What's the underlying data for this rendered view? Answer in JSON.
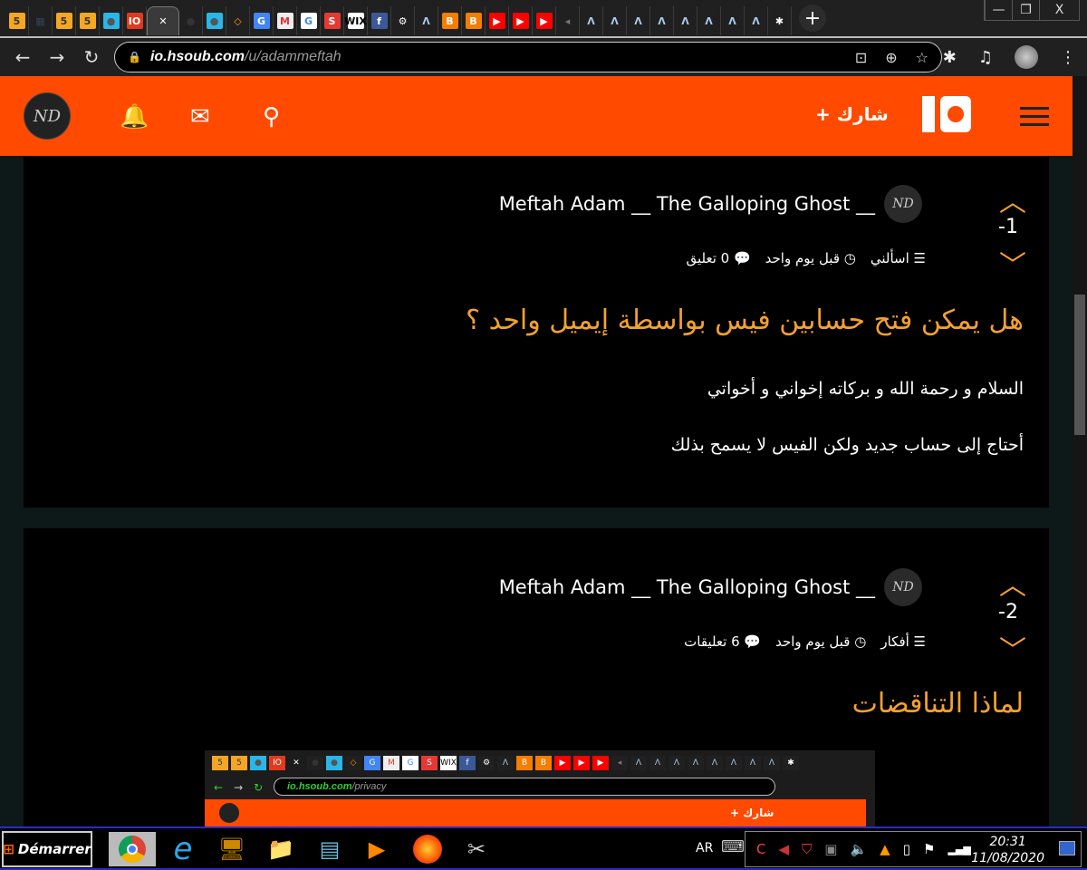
{
  "browser": {
    "tabs": [
      {
        "icon": "html5-icon",
        "glyph": "5",
        "bg": "#f5a623",
        "fg": "#333"
      },
      {
        "icon": "grid-icon",
        "glyph": "▦",
        "bg": "#202020",
        "fg": "#345"
      },
      {
        "icon": "html5-icon",
        "glyph": "5",
        "bg": "#f5a623",
        "fg": "#333"
      },
      {
        "icon": "html5-icon",
        "glyph": "5",
        "bg": "#f5a623",
        "fg": "#333"
      },
      {
        "icon": "circle-app-icon",
        "glyph": "●",
        "bg": "#29b6e8",
        "fg": "#555"
      },
      {
        "icon": "io-icon",
        "glyph": "IO",
        "bg": "#e03a1e",
        "fg": "#fff"
      },
      {
        "icon": "close-icon",
        "glyph": "✕",
        "active": true
      },
      {
        "icon": "dot-icon",
        "glyph": "●",
        "bg": "#202020",
        "fg": "#333"
      },
      {
        "icon": "circle-app-icon",
        "glyph": "●",
        "bg": "#29b6e8",
        "fg": "#555"
      },
      {
        "icon": "diamond-icon",
        "glyph": "◇",
        "bg": "#202020",
        "fg": "#f90"
      },
      {
        "icon": "google-translate-icon",
        "glyph": "G",
        "bg": "#4285f4",
        "fg": "#fff"
      },
      {
        "icon": "gmail-icon",
        "glyph": "M",
        "bg": "#eee",
        "fg": "#d33"
      },
      {
        "icon": "google-icon",
        "glyph": "G",
        "bg": "#fff",
        "fg": "#4285f4"
      },
      {
        "icon": "s-icon",
        "glyph": "S",
        "bg": "#e53935",
        "fg": "#fff"
      },
      {
        "icon": "wix-icon",
        "glyph": "WIX",
        "bg": "#fff",
        "fg": "#000"
      },
      {
        "icon": "facebook-icon",
        "glyph": "f",
        "bg": "#3b5998",
        "fg": "#fff"
      },
      {
        "icon": "gear-icon",
        "glyph": "⚙",
        "bg": "#202020",
        "fg": "#fff"
      },
      {
        "icon": "lambda-icon",
        "glyph": "Λ",
        "bg": "#202020",
        "fg": "#ace"
      },
      {
        "icon": "blogger-icon",
        "glyph": "B",
        "bg": "#f57d00",
        "fg": "#fff"
      },
      {
        "icon": "blogger-icon",
        "glyph": "B",
        "bg": "#f57d00",
        "fg": "#fff"
      },
      {
        "icon": "youtube-icon",
        "glyph": "▶",
        "bg": "#f00",
        "fg": "#fff"
      },
      {
        "icon": "youtube-icon",
        "glyph": "▶",
        "bg": "#f00",
        "fg": "#fff"
      },
      {
        "icon": "youtube-icon",
        "glyph": "▶",
        "bg": "#f00",
        "fg": "#fff"
      },
      {
        "icon": "speaker-icon",
        "glyph": "◂",
        "bg": "#202020",
        "fg": "#777"
      },
      {
        "icon": "lambda-icon",
        "glyph": "Λ",
        "bg": "#202020",
        "fg": "#ace"
      },
      {
        "icon": "lambda-icon",
        "glyph": "Λ",
        "bg": "#202020",
        "fg": "#ace"
      },
      {
        "icon": "lambda-icon",
        "glyph": "Λ",
        "bg": "#202020",
        "fg": "#ace"
      },
      {
        "icon": "lambda-icon",
        "glyph": "Λ",
        "bg": "#202020",
        "fg": "#ace"
      },
      {
        "icon": "lambda-icon",
        "glyph": "Λ",
        "bg": "#202020",
        "fg": "#ace"
      },
      {
        "icon": "lambda-icon",
        "glyph": "Λ",
        "bg": "#202020",
        "fg": "#ace"
      },
      {
        "icon": "lambda-icon",
        "glyph": "Λ",
        "bg": "#202020",
        "fg": "#ace"
      },
      {
        "icon": "lambda-icon",
        "glyph": "Λ",
        "bg": "#202020",
        "fg": "#ace"
      },
      {
        "icon": "puzzle-icon",
        "glyph": "✱",
        "bg": "#202020",
        "fg": "#fff"
      }
    ],
    "url_host": "io.hsoub.com",
    "url_path": "/u/adammeftah"
  },
  "header": {
    "share_label": "+ شارك",
    "avatar_text": "ND",
    "accent": "#ff4a00"
  },
  "posts": [
    {
      "score": "-1",
      "author": "Meftah Adam __ The Galloping Ghost __",
      "category": "اسألني",
      "time": "قبل يوم واحد",
      "comments": "0 تعليق",
      "title": "هل يمكن فتح حسابين فيس بواسطة إيميل واحد ؟",
      "body": [
        "السلام و رحمة الله و بركاته إخواني و أخواتي",
        "أحتاج إلى حساب جديد ولكن الفيس لا يسمح بذلك"
      ]
    },
    {
      "score": "-2",
      "author": "Meftah Adam __ The Galloping Ghost __",
      "category": "أفكار",
      "time": "قبل يوم واحد",
      "comments": "6 تعليقات",
      "title": "لماذا التناقضات",
      "body": []
    }
  ],
  "embedded_screenshot": {
    "url_host": "io.hsoub.com",
    "url_path": "/privacy",
    "share_label": "+ شارك"
  },
  "taskbar": {
    "start_label": "Démarrer",
    "lang": "AR",
    "time": "20:31",
    "date": "11/08/2020"
  }
}
